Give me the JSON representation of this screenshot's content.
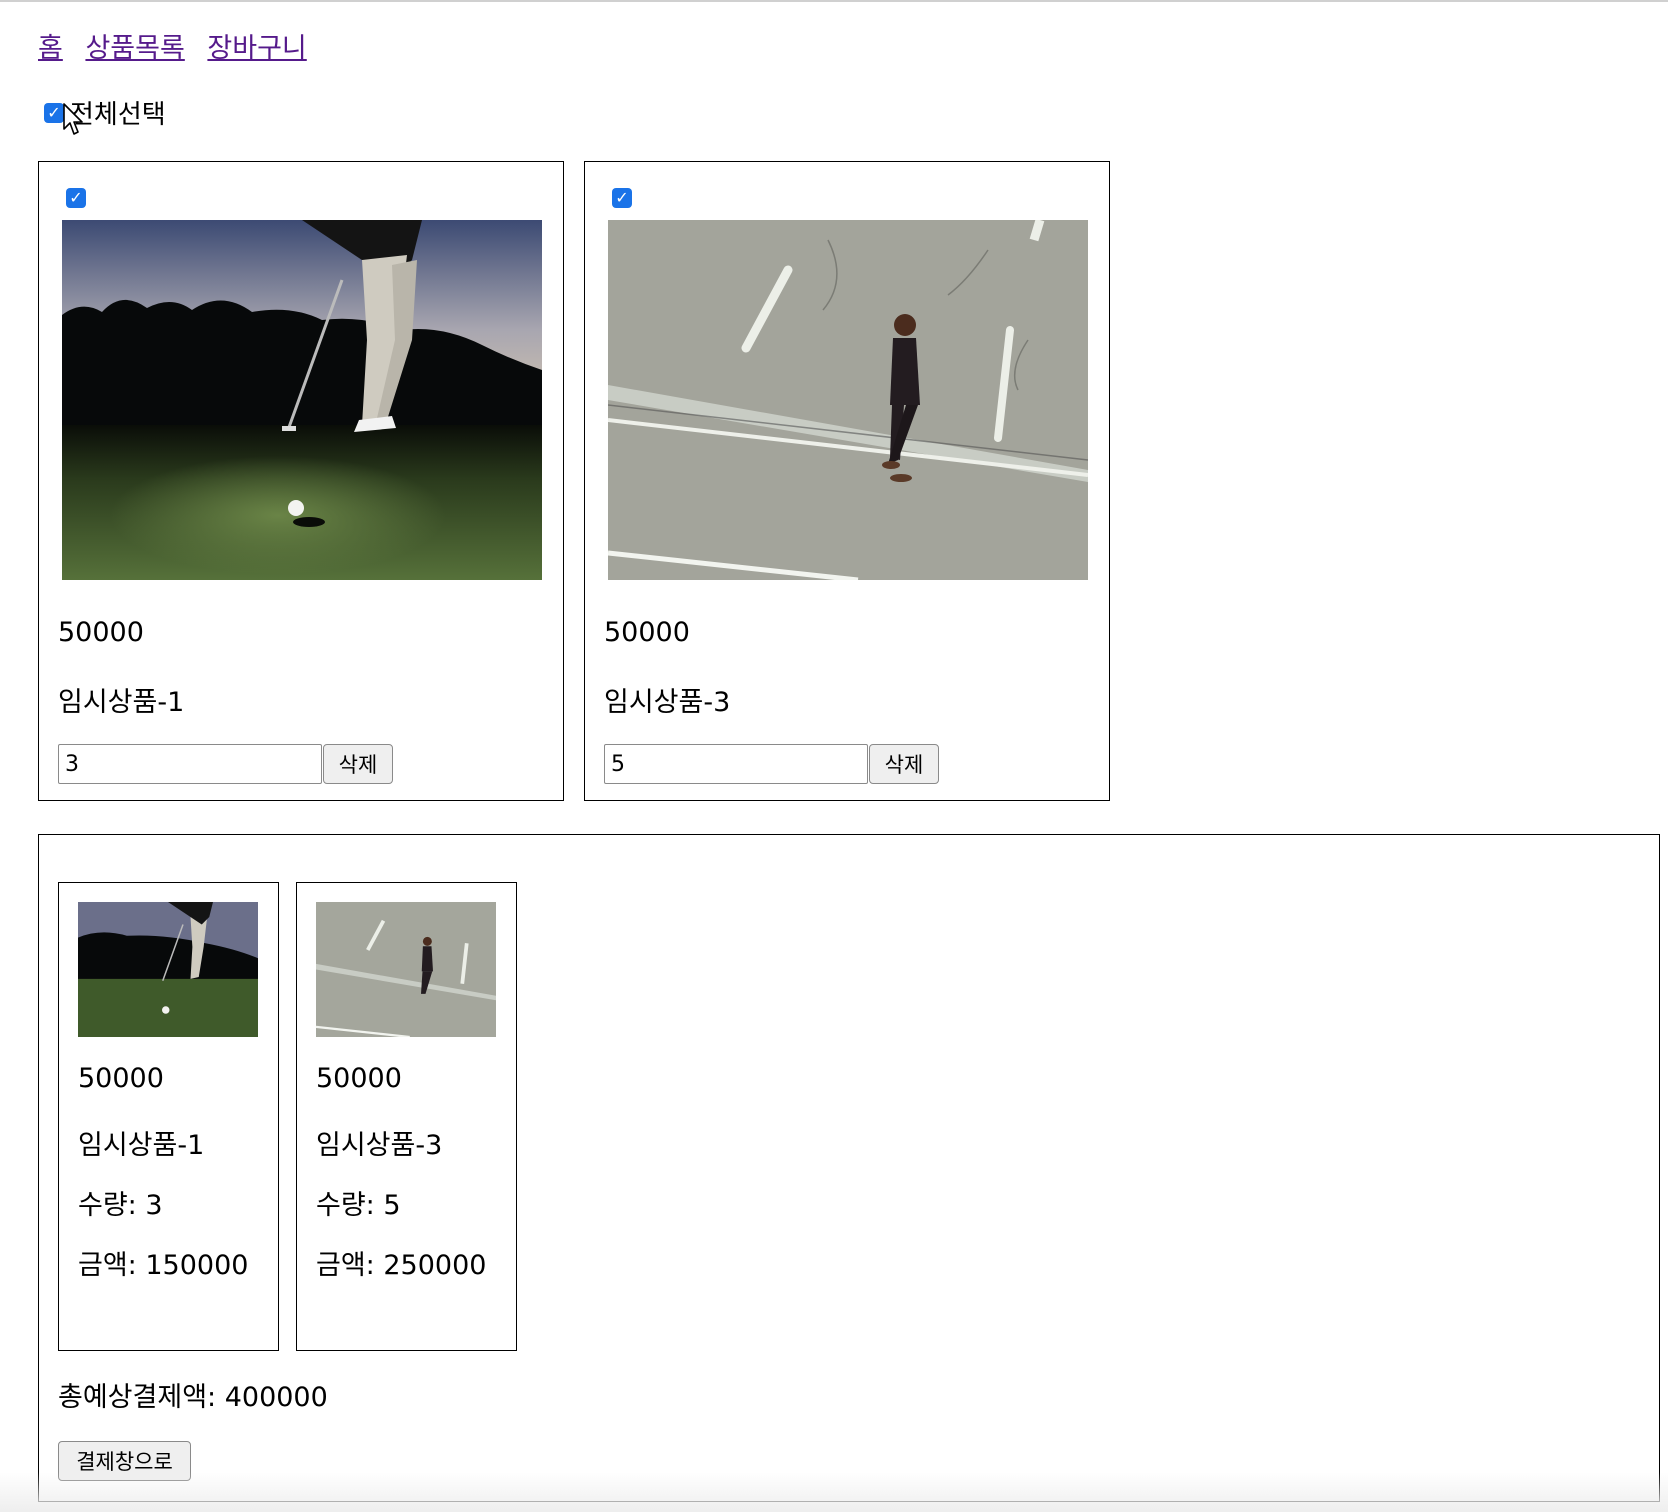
{
  "nav": {
    "links": [
      "홈",
      "상품목록",
      "장바구니"
    ]
  },
  "select_all": {
    "label": "전체선택",
    "checked": true
  },
  "cart_items": [
    {
      "image": "golf-putting-photo",
      "price": "50000",
      "name": "임시상품-1",
      "quantity": "3",
      "delete_label": "삭제",
      "checked": true
    },
    {
      "image": "man-walking-road-photo",
      "price": "50000",
      "name": "임시상품-3",
      "quantity": "5",
      "delete_label": "삭제",
      "checked": true
    }
  ],
  "summary": {
    "items": [
      {
        "image": "golf-putting-photo",
        "price": "50000",
        "name": "임시상품-1",
        "quantity_text": "수량: 3",
        "amount_text": "금액: 150000"
      },
      {
        "image": "man-walking-road-photo",
        "price": "50000",
        "name": "임시상품-3",
        "quantity_text": "수량: 5",
        "amount_text": "금액: 250000"
      }
    ],
    "total_text": "총예상결제액: 400000",
    "checkout_label": "결제창으로"
  },
  "colors": {
    "link": "#551a8b",
    "checkbox": "#1a73e8"
  }
}
